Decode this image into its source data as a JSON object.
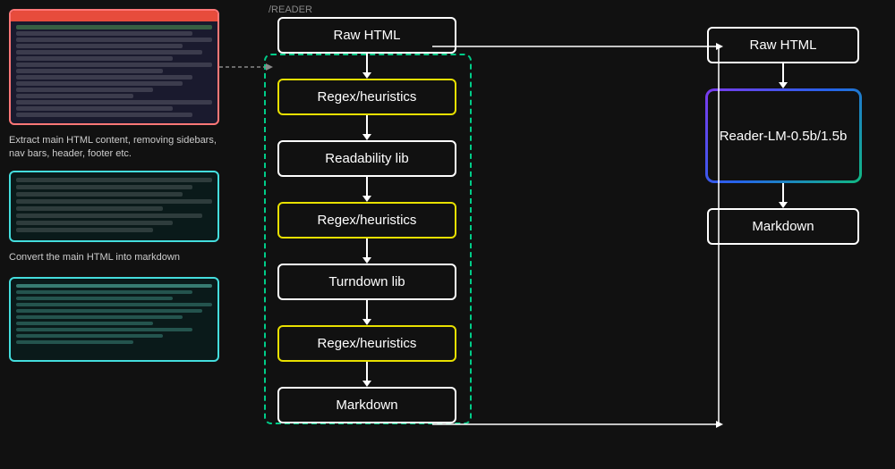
{
  "leftPanel": {
    "caption1": "Extract main HTML content, removing sidebars, nav bars, header, footer etc.",
    "caption2": "Convert the main HTML into markdown"
  },
  "middleFlow": {
    "label": "/READER",
    "nodes": [
      {
        "id": "raw-html-1",
        "label": "Raw HTML",
        "border": "white"
      },
      {
        "id": "regex-1",
        "label": "Regex/heuristics",
        "border": "yellow"
      },
      {
        "id": "readability",
        "label": "Readability lib",
        "border": "white"
      },
      {
        "id": "regex-2",
        "label": "Regex/heuristics",
        "border": "yellow"
      },
      {
        "id": "turndown",
        "label": "Turndown lib",
        "border": "white"
      },
      {
        "id": "regex-3",
        "label": "Regex/heuristics",
        "border": "yellow"
      },
      {
        "id": "markdown-1",
        "label": "Markdown",
        "border": "white"
      }
    ]
  },
  "rightFlow": {
    "nodes": [
      {
        "id": "raw-html-2",
        "label": "Raw HTML"
      },
      {
        "id": "reader-lm",
        "label": "Reader-LM-0.5b/1.5b"
      },
      {
        "id": "markdown-2",
        "label": "Markdown"
      }
    ]
  },
  "colors": {
    "yellow": "#e8e000",
    "teal": "#00cc88",
    "red": "#e74c3c",
    "cyan": "#4dd",
    "gradientPurple": "#7c3aed",
    "gradientBlue": "#2563eb",
    "gradientGreen": "#10b981"
  }
}
